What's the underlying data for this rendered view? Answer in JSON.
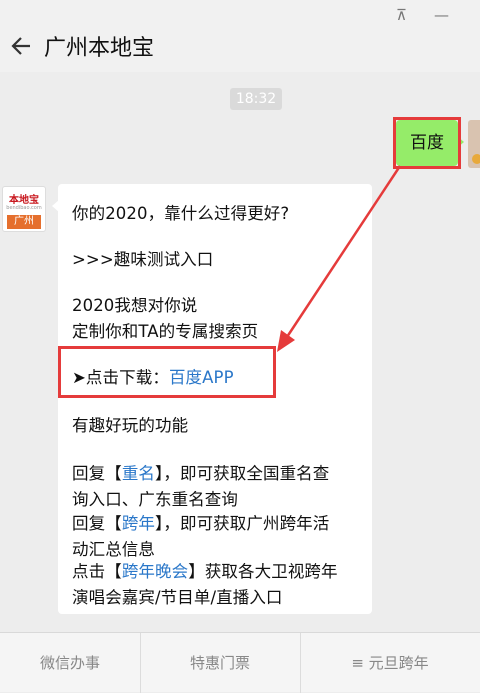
{
  "window": {
    "pin_icon": "⊼",
    "minimize_icon": "—"
  },
  "chat": {
    "title": "广州本地宝",
    "time": "18:32",
    "sent_message": "百度",
    "avatar_left": {
      "top": "本地宝",
      "mid": "bendibao.com",
      "bottom": "广州"
    },
    "reply_lines": [
      {
        "parts": [
          {
            "text": "你的2020，靠什么过得更好?"
          }
        ]
      },
      {
        "parts": [
          {
            "text": ">>>趣味测试入口"
          }
        ]
      },
      {
        "parts": [
          {
            "text": "2020我想对你说"
          }
        ]
      },
      {
        "parts": [
          {
            "text": "定制你和TA的专属搜索页"
          }
        ]
      },
      {
        "parts": [
          {
            "text": "➤点击下载："
          },
          {
            "text": "百度APP",
            "link": true
          }
        ]
      },
      {
        "parts": [
          {
            "text": "有趣好玩的功能"
          }
        ]
      },
      {
        "parts": [
          {
            "text": "回复【"
          },
          {
            "text": "重名",
            "link": true
          },
          {
            "text": "】，即可获取全国重名查"
          }
        ]
      },
      {
        "parts": [
          {
            "text": "询入口、广东重名查询"
          }
        ]
      },
      {
        "parts": [
          {
            "text": "回复【"
          },
          {
            "text": "跨年",
            "link": true
          },
          {
            "text": "】，即可获取广州跨年活"
          }
        ]
      },
      {
        "parts": [
          {
            "text": "动汇总信息"
          }
        ]
      },
      {
        "parts": [
          {
            "text": "点击【"
          },
          {
            "text": "跨年晚会",
            "link": true
          },
          {
            "text": "】获取各大卫视跨年"
          }
        ]
      },
      {
        "parts": [
          {
            "text": "演唱会嘉宾/节目单/直播入口"
          }
        ]
      }
    ]
  },
  "bottom_menu": [
    {
      "label": "微信办事"
    },
    {
      "label": "特惠门票"
    },
    {
      "label": "≡ 元旦跨年"
    }
  ],
  "colors": {
    "sent_bubble": "#95ec69",
    "link": "#2a77c9",
    "highlight": "#e53b3b"
  }
}
